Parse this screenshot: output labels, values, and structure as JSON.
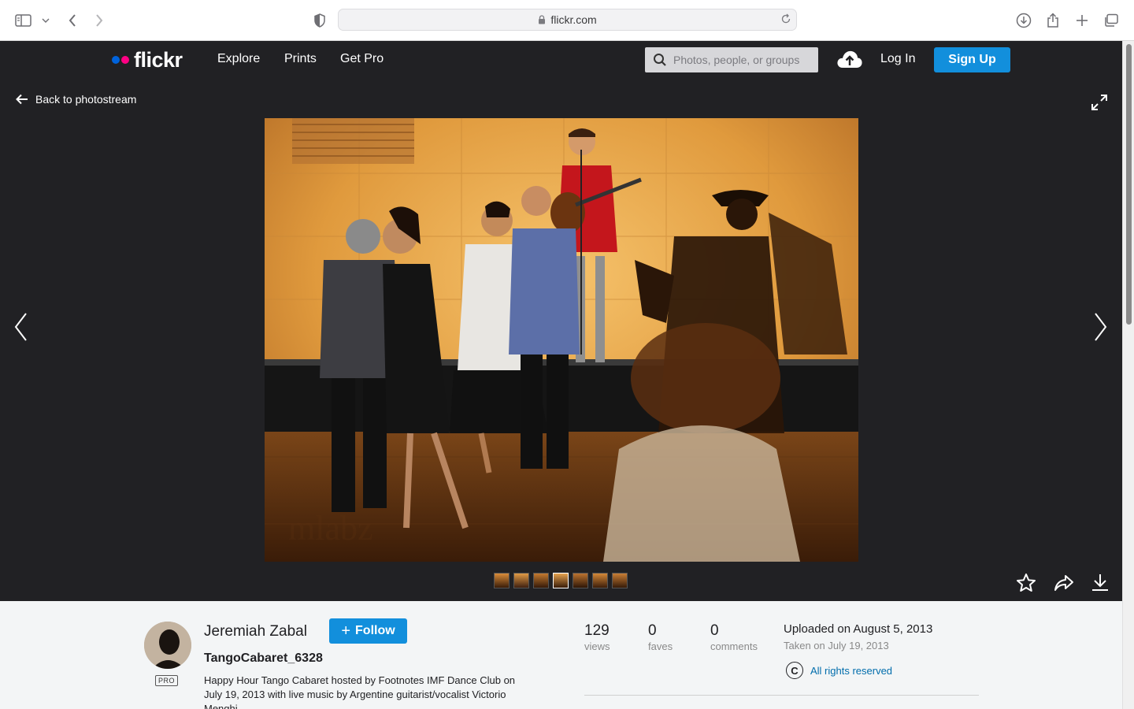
{
  "browser": {
    "url": "flickr.com"
  },
  "header": {
    "logo_text": "flickr",
    "nav": [
      "Explore",
      "Prints",
      "Get Pro"
    ],
    "search_placeholder": "Photos, people, or groups",
    "login_label": "Log In",
    "signup_label": "Sign Up",
    "colors": {
      "dot_blue": "#0063dc",
      "dot_pink": "#ff0084",
      "accent": "#128fdc"
    }
  },
  "stage": {
    "back_label": "Back to photostream",
    "thumbnail_count": 7,
    "active_thumbnail": 4
  },
  "info": {
    "author": "Jeremiah Zabal",
    "pro_label": "PRO",
    "follow_label": "Follow",
    "title": "TangoCabaret_6328",
    "description": "Happy Hour Tango Cabaret hosted by Footnotes IMF Dance Club on July 19, 2013 with live music by Argentine guitarist/vocalist Victorio Menghi",
    "stats": [
      {
        "value": "129",
        "label": "views"
      },
      {
        "value": "0",
        "label": "faves"
      },
      {
        "value": "0",
        "label": "comments"
      }
    ],
    "uploaded": "Uploaded on August 5, 2013",
    "taken": "Taken on July 19, 2013",
    "rights_symbol": "C",
    "rights": "All rights reserved"
  }
}
